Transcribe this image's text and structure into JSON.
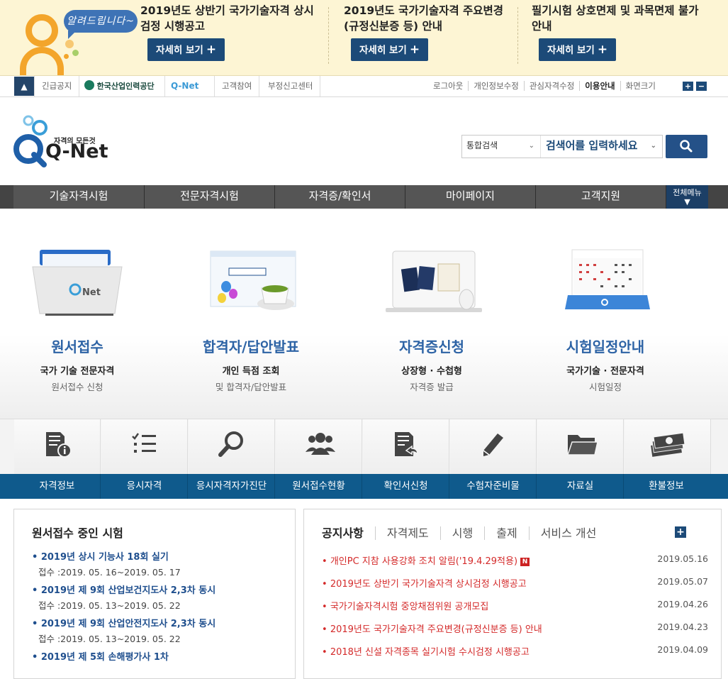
{
  "notice": {
    "bubble": "알려드립니다~",
    "items": [
      {
        "text": "2019년도 상반기 국가기술자격 상시검정 시행공고",
        "button": "자세히 보기"
      },
      {
        "text": "2019년도 국가기술자격 주요변경(규정신분증 등) 안내",
        "button": "자세히 보기"
      },
      {
        "text": "필기시험 상호면제 및 과목면제 불가 안내",
        "button": "자세히 보기"
      }
    ]
  },
  "util": {
    "left": [
      "긴급공지",
      "한국산업인력공단",
      "Q-Net",
      "고객참여",
      "부정신고센터"
    ],
    "right": [
      "로그아웃",
      "개인정보수정",
      "관심자격수정",
      "이용안내",
      "화면크기"
    ]
  },
  "header": {
    "logo_tagline": "자격의 모든것",
    "logo_text": "Q-Net",
    "search_scope": "통합검색",
    "search_placeholder": "검색어를 입력하세요"
  },
  "gnb": {
    "items": [
      "기술자격시험",
      "전문자격시험",
      "자격증/확인서",
      "마이페이지",
      "고객지원"
    ],
    "all_menu": "전체메뉴"
  },
  "quick": [
    {
      "title": "원서접수",
      "sub1": "국가 기술 전문자격",
      "sub2": "원서접수 신청"
    },
    {
      "title": "합격자/답안발표",
      "sub1": "개인 득점 조회",
      "sub2": "및 합격자/답안발표"
    },
    {
      "title": "자격증신청",
      "sub1": "상장형 · 수첩형",
      "sub2": "자격증 발급"
    },
    {
      "title": "시험일정안내",
      "sub1": "국가기술 · 전문자격",
      "sub2": "시험일정"
    }
  ],
  "icon_menu": [
    {
      "label": "자격정보",
      "icon": "document-info-icon"
    },
    {
      "label": "응시자격",
      "icon": "checklist-icon"
    },
    {
      "label": "응시자격자가진단",
      "icon": "magnifier-icon"
    },
    {
      "label": "원서접수현황",
      "icon": "people-icon"
    },
    {
      "label": "확인서신청",
      "icon": "document-reply-icon"
    },
    {
      "label": "수험자준비물",
      "icon": "pencil-icon"
    },
    {
      "label": "자료실",
      "icon": "folder-icon"
    },
    {
      "label": "환불정보",
      "icon": "money-icon"
    }
  ],
  "exams": {
    "title": "원서접수 중인 시험",
    "items": [
      {
        "name": "• 2019년 상시 기능사 18회 실기",
        "period": "접수 :2019. 05. 16~2019. 05. 17"
      },
      {
        "name": "• 2019년 제 9회 산업보건지도사 2,3차 동시",
        "period": "접수 :2019. 05. 13~2019. 05. 22"
      },
      {
        "name": "• 2019년 제 9회 산업안전지도사 2,3차 동시",
        "period": "접수 :2019. 05. 13~2019. 05. 22"
      },
      {
        "name": "• 2019년 제 5회 손해평가사 1차",
        "period": ""
      }
    ]
  },
  "notices": {
    "tabs": [
      "공지사항",
      "자격제도",
      "시행",
      "출제",
      "서비스 개선"
    ],
    "items": [
      {
        "title": "개인PC 지참 사용강화 조치 알림('19.4.29적용)",
        "date": "2019.05.16",
        "badge": "N"
      },
      {
        "title": "2019년도 상반기 국가기술자격 상시검정 시행공고",
        "date": "2019.05.07"
      },
      {
        "title": "국가기술자격시험 중앙채점위원 공개모집",
        "date": "2019.04.26"
      },
      {
        "title": "2019년도 국가기술자격 주요변경(규정신분증 등) 안내",
        "date": "2019.04.23"
      },
      {
        "title": "2018년 신설 자격종목 실기시험 수시검정 시행공고",
        "date": "2019.04.09"
      }
    ]
  }
}
